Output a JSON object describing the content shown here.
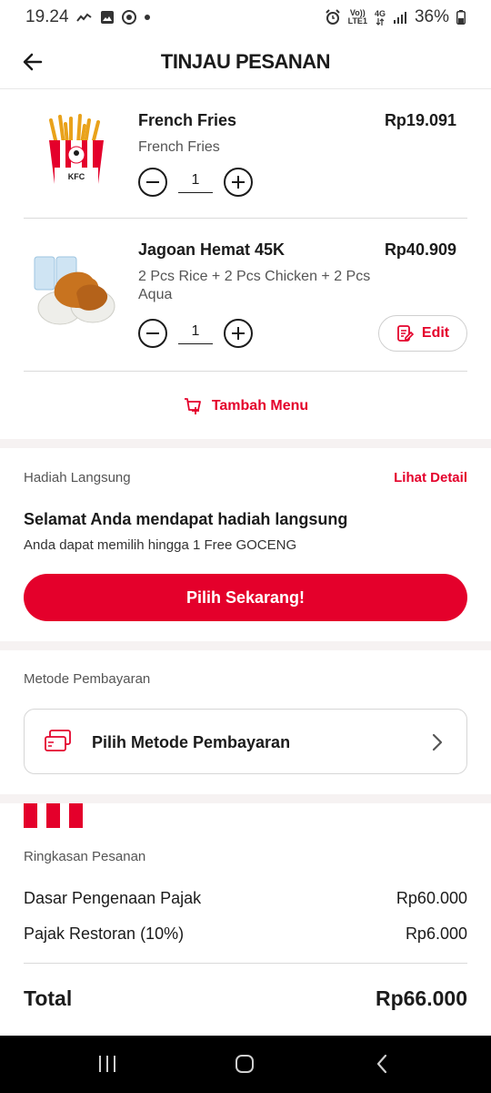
{
  "status_bar": {
    "time": "19.24",
    "battery": "36%",
    "network_top": "Vo))",
    "network_bottom": "LTE1",
    "net_type": "4G"
  },
  "header": {
    "title": "TINJAU PESANAN"
  },
  "items": [
    {
      "name": "French Fries",
      "price": "Rp19.091",
      "desc": "French Fries",
      "qty": "1",
      "image_label": "KFC"
    },
    {
      "name": "Jagoan Hemat 45K",
      "price": "Rp40.909",
      "desc": "2 Pcs Rice + 2 Pcs Chicken + 2 Pcs Aqua",
      "qty": "1",
      "edit_label": "Edit"
    }
  ],
  "add_menu_label": "Tambah Menu",
  "gift": {
    "section_label": "Hadiah Langsung",
    "detail_link": "Lihat Detail",
    "title": "Selamat Anda mendapat hadiah langsung",
    "subtitle": "Anda dapat memilih hingga 1 Free GOCENG",
    "button": "Pilih Sekarang!"
  },
  "payment": {
    "section_label": "Metode Pembayaran",
    "select_label": "Pilih Metode Pembayaran"
  },
  "summary": {
    "section_label": "Ringkasan Pesanan",
    "rows": [
      {
        "label": "Dasar Pengenaan Pajak",
        "value": "Rp60.000"
      },
      {
        "label": "Pajak Restoran (10%)",
        "value": "Rp6.000"
      }
    ],
    "total_label": "Total",
    "total_value": "Rp66.000"
  },
  "colors": {
    "accent": "#e4002b",
    "text": "#1b1b1b",
    "muted": "#555555"
  }
}
